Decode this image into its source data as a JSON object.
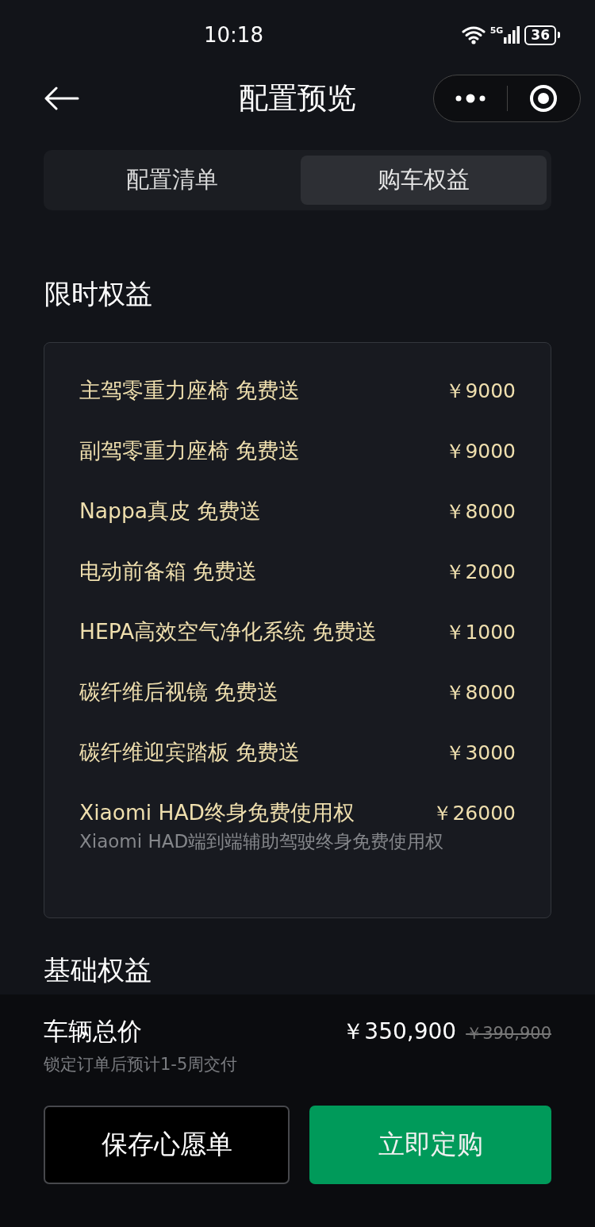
{
  "status_bar": {
    "time": "10:18",
    "network": "5G",
    "battery": "36"
  },
  "nav": {
    "title": "配置预览"
  },
  "tabs": [
    {
      "label": "配置清单",
      "selected": false
    },
    {
      "label": "购车权益",
      "selected": true
    }
  ],
  "sections": [
    {
      "title": "限时权益",
      "benefits": [
        {
          "name": "主驾零重力座椅 免费送",
          "price": "￥9000"
        },
        {
          "name": "副驾零重力座椅 免费送",
          "price": "￥9000"
        },
        {
          "name": "Nappa真皮 免费送",
          "price": "￥8000"
        },
        {
          "name": "电动前备箱 免费送",
          "price": "￥2000"
        },
        {
          "name": "HEPA高效空气净化系统 免费送",
          "price": "￥1000"
        },
        {
          "name": "碳纤维后视镜 免费送",
          "price": "￥8000"
        },
        {
          "name": "碳纤维迎宾踏板 免费送",
          "price": "￥3000"
        },
        {
          "name": "Xiaomi HAD终身免费使用权",
          "price": "￥26000",
          "note": "Xiaomi HAD端到端辅助驾驶终身免费使用权"
        }
      ]
    },
    {
      "title": "基础权益"
    }
  ],
  "footer": {
    "label": "车辆总价",
    "price": "￥350,900",
    "original_price": "￥390,900",
    "note": "锁定订单后预计1-5周交付",
    "buttons": [
      {
        "label": "保存心愿单",
        "kind": "outline"
      },
      {
        "label": "立即定购",
        "kind": "primary"
      }
    ]
  }
}
